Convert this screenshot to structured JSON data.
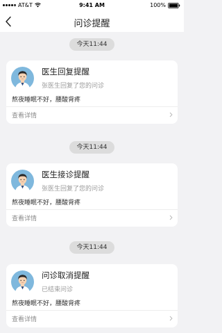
{
  "status_bar": {
    "carrier": "AT&T",
    "time": "9:41 AM",
    "battery": "100%"
  },
  "nav": {
    "title": "问诊提醒"
  },
  "messages": [
    {
      "time": "今天11:44",
      "title": "医生回复提醒",
      "subtitle": "张医生回复了您的问诊",
      "body": "熬夜睡眠不好，腰酸背疼",
      "detail": "查看详情"
    },
    {
      "time": "今天11:44",
      "title": "医生接诊提醒",
      "subtitle": "张医生回复了您的问诊",
      "body": "熬夜睡眠不好，腰酸背疼",
      "detail": "查看详情"
    },
    {
      "time": "今天11:44",
      "title": "问诊取消提醒",
      "subtitle": "已结束问诊",
      "body": "熬夜睡眠不好，腰酸背疼",
      "detail": "查看详情"
    }
  ],
  "colors": {
    "background": "#f2f2f4",
    "pill": "#dcdcdc",
    "avatar_bg": "#7fb8dd"
  },
  "icons": {
    "back": "chevron-left-icon",
    "detail": "chevron-right-icon",
    "avatar": "doctor-avatar-icon",
    "wifi": "wifi-icon",
    "battery": "battery-icon"
  }
}
